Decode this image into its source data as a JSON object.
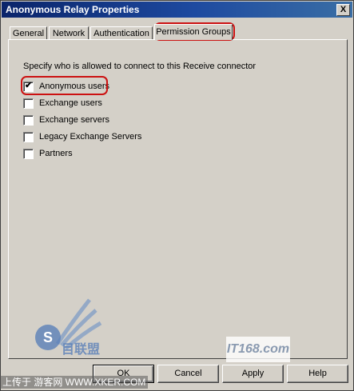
{
  "window": {
    "title": "Anonymous Relay Properties",
    "close_label": "X"
  },
  "tabs": [
    {
      "label": "General"
    },
    {
      "label": "Network"
    },
    {
      "label": "Authentication"
    },
    {
      "label": "Permission Groups"
    }
  ],
  "active_tab": "Permission Groups",
  "page": {
    "description": "Specify who is allowed to connect to this Receive connector",
    "options": [
      {
        "label": "Anonymous users",
        "checked": true
      },
      {
        "label": "Exchange users",
        "checked": false
      },
      {
        "label": "Exchange servers",
        "checked": false
      },
      {
        "label": "Legacy Exchange Servers",
        "checked": false
      },
      {
        "label": "Partners",
        "checked": false
      }
    ]
  },
  "buttons": {
    "ok": "OK",
    "cancel": "Cancel",
    "apply": "Apply",
    "help": "Help"
  },
  "watermark": {
    "footer_text": "上传于 游客网 WWW.XKER.COM",
    "logo_text": "IT168.com",
    "logo_s": "S",
    "logo_cn": "目联盟"
  },
  "colors": {
    "highlight": "#cc1111",
    "titlebar": "#0a246a",
    "face": "#d4d0c8"
  }
}
